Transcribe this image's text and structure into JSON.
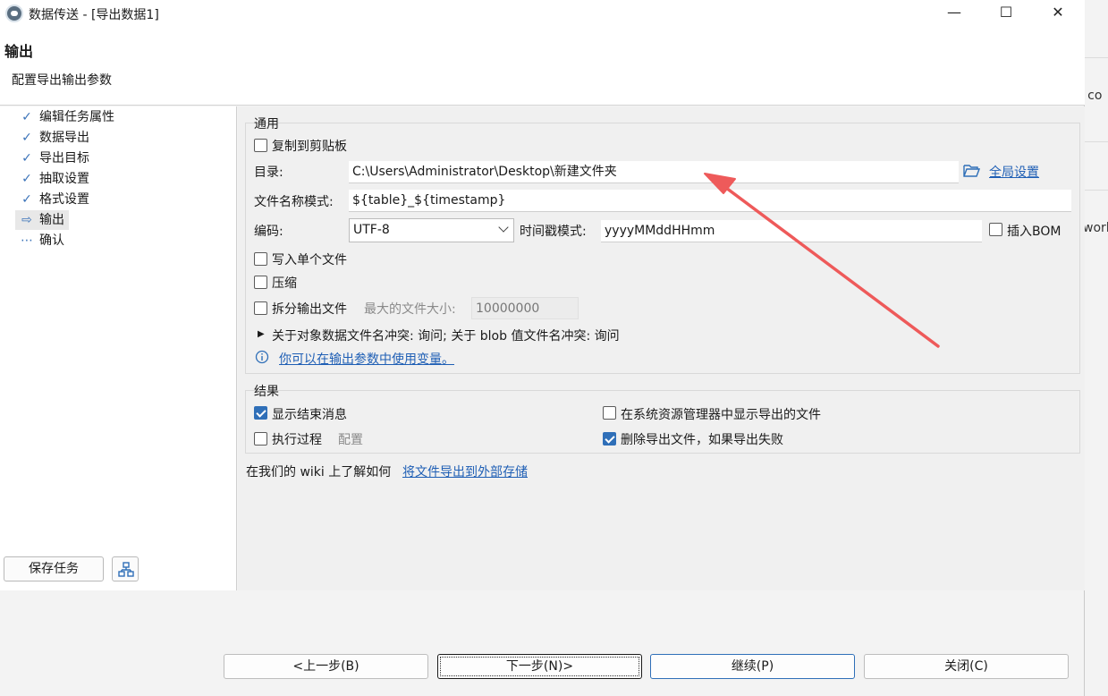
{
  "window": {
    "title": "数据传送 - [导出数据1]",
    "minimize": "—",
    "maximize": "☐",
    "close": "✕"
  },
  "header": {
    "title": "输出",
    "description": "配置导出输出参数"
  },
  "nav": {
    "items": [
      {
        "label": "编辑任务属性",
        "icon": "check-icon",
        "glyph": "✓"
      },
      {
        "label": "数据导出",
        "icon": "check-icon",
        "glyph": "✓"
      },
      {
        "label": "导出目标",
        "icon": "check-icon",
        "glyph": "✓"
      },
      {
        "label": "抽取设置",
        "icon": "check-icon",
        "glyph": "✓"
      },
      {
        "label": "格式设置",
        "icon": "check-icon",
        "glyph": "✓"
      },
      {
        "label": "输出",
        "icon": "arrow-right-icon",
        "glyph": "⇨"
      },
      {
        "label": "确认",
        "icon": "dots-icon",
        "glyph": "⋯"
      }
    ],
    "save_task": "保存任务"
  },
  "general": {
    "title": "通用",
    "copy_to_clipboard": "复制到剪贴板",
    "copy_to_clipboard_checked": false,
    "directory_label": "目录:",
    "directory_value": "C:\\Users\\Administrator\\Desktop\\新建文件夹",
    "global_settings": "全局设置",
    "file_name_pattern_label": "文件名称模式:",
    "file_name_pattern_value": "${table}_${timestamp}",
    "encoding_label": "编码:",
    "encoding_value": "UTF-8",
    "timestamp_pattern_label": "时间戳模式:",
    "timestamp_pattern_value": "yyyyMMddHHmm",
    "insert_bom": "插入BOM",
    "insert_bom_checked": false,
    "write_single_file": "写入单个文件",
    "compress": "压缩",
    "split_output": "拆分输出文件",
    "max_file_size_label": "最大的文件大小:",
    "max_file_size_value": "10000000",
    "conflict_text": "关于对象数据文件名冲突: 询问; 关于 blob 值文件名冲突: 询问",
    "variables_hint": "你可以在输出参数中使用变量。"
  },
  "results": {
    "title": "结果",
    "show_finish_message": "显示结束消息",
    "show_finish_message_checked": true,
    "show_in_explorer": "在系统资源管理器中显示导出的文件",
    "show_in_explorer_checked": false,
    "execute_process": "执行过程",
    "execute_process_checked": false,
    "configure": "配置",
    "delete_on_fail": "删除导出文件，如果导出失败",
    "delete_on_fail_checked": true
  },
  "wiki": {
    "prefix": "在我们的 wiki 上了解如何",
    "link": "将文件导出到外部存储"
  },
  "footer": {
    "back": "<上一步(B)",
    "next": "下一步(N)>",
    "continue": "继续(P)",
    "close": "关闭(C)"
  },
  "background_app": {
    "text_top": "y, co",
    "text_mid": "worl"
  },
  "colors": {
    "accent": "#2f6fb8",
    "link": "#1f5fb5",
    "annotation_arrow": "#ee5a5a"
  }
}
